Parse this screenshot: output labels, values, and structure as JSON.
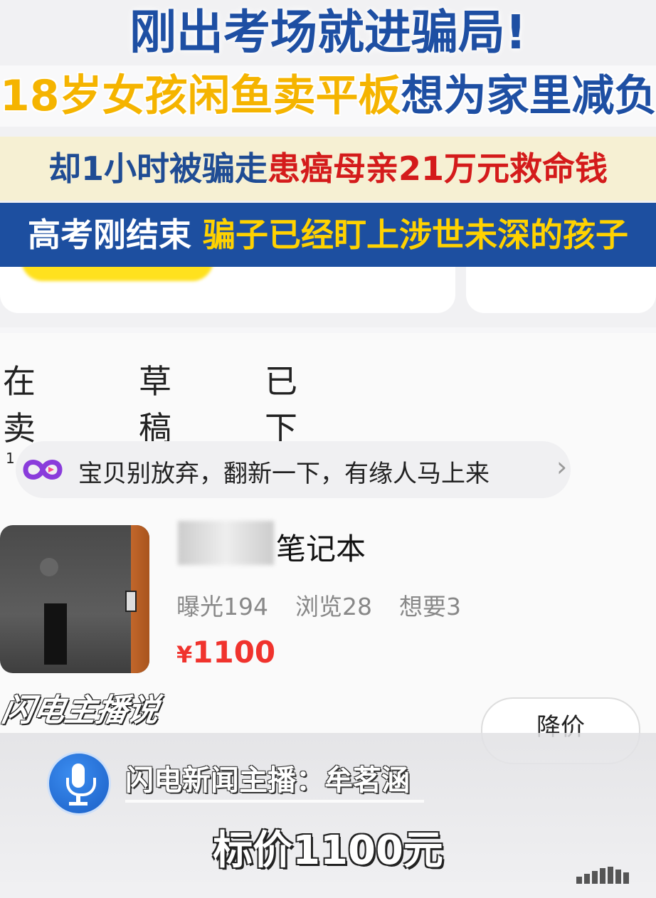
{
  "headline": {
    "line1": "刚出考场就进骗局!",
    "line2_part1": "18岁女孩闲鱼卖平板",
    "line2_part2": "想为家里减负",
    "line3_part1": "却1小时被骗走",
    "line3_part2": "患癌母亲21万元救命钱",
    "line4_part1": "高考刚结束",
    "line4_part2": "骗子已经盯上涉世未深的孩子"
  },
  "tabs": [
    {
      "label": "在卖",
      "count": "1"
    },
    {
      "label": "草稿"
    },
    {
      "label": "已下架"
    }
  ],
  "tip": {
    "text": "宝贝别放弃，翻新一下，有缘人马上来",
    "arrow": "›"
  },
  "item": {
    "title": "笔记本",
    "stats": [
      "曝光194",
      "浏览28",
      "想要3"
    ],
    "currency": "¥",
    "price": "1100",
    "reduce_label": "降价"
  },
  "watermark": "闪电主播说",
  "anchor": "闪电新闻主播：牟茗涵",
  "subtitle": "标价1100元",
  "colors": {
    "brand_yellow": "#ffe11e",
    "price_red": "#f0332d",
    "headline_blue": "#1e4fa3",
    "warning_red": "#d41b1b"
  }
}
